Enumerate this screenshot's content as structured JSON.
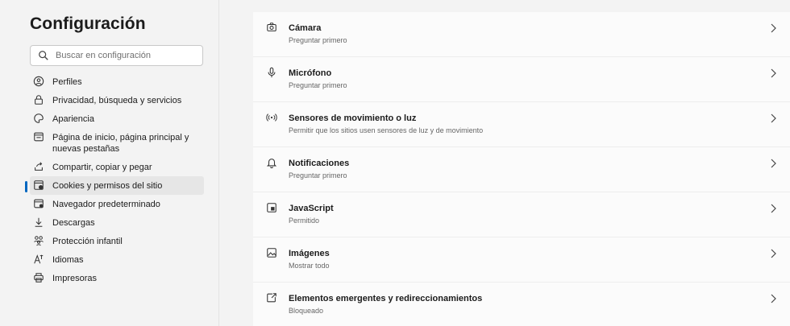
{
  "sidebar": {
    "title": "Configuración",
    "search_placeholder": "Buscar en configuración",
    "items": [
      {
        "label": "Perfiles"
      },
      {
        "label": "Privacidad, búsqueda y servicios"
      },
      {
        "label": "Apariencia"
      },
      {
        "label": "Página de inicio, página principal y nuevas pestañas"
      },
      {
        "label": "Compartir, copiar y pegar"
      },
      {
        "label": "Cookies y permisos del sitio"
      },
      {
        "label": "Navegador predeterminado"
      },
      {
        "label": "Descargas"
      },
      {
        "label": "Protección infantil"
      },
      {
        "label": "Idiomas"
      },
      {
        "label": "Impresoras"
      }
    ]
  },
  "main": {
    "rows": [
      {
        "title": "Cámara",
        "subtitle": "Preguntar primero"
      },
      {
        "title": "Micrófono",
        "subtitle": "Preguntar primero"
      },
      {
        "title": "Sensores de movimiento o luz",
        "subtitle": "Permitir que los sitios usen sensores de luz y de movimiento"
      },
      {
        "title": "Notificaciones",
        "subtitle": "Preguntar primero"
      },
      {
        "title": "JavaScript",
        "subtitle": "Permitido"
      },
      {
        "title": "Imágenes",
        "subtitle": "Mostrar todo"
      },
      {
        "title": "Elementos emergentes y redireccionamientos",
        "subtitle": "Bloqueado"
      }
    ]
  },
  "colors": {
    "accent": "#0067c0",
    "panel": "#fbfbfb",
    "background": "#f3f3f3"
  }
}
